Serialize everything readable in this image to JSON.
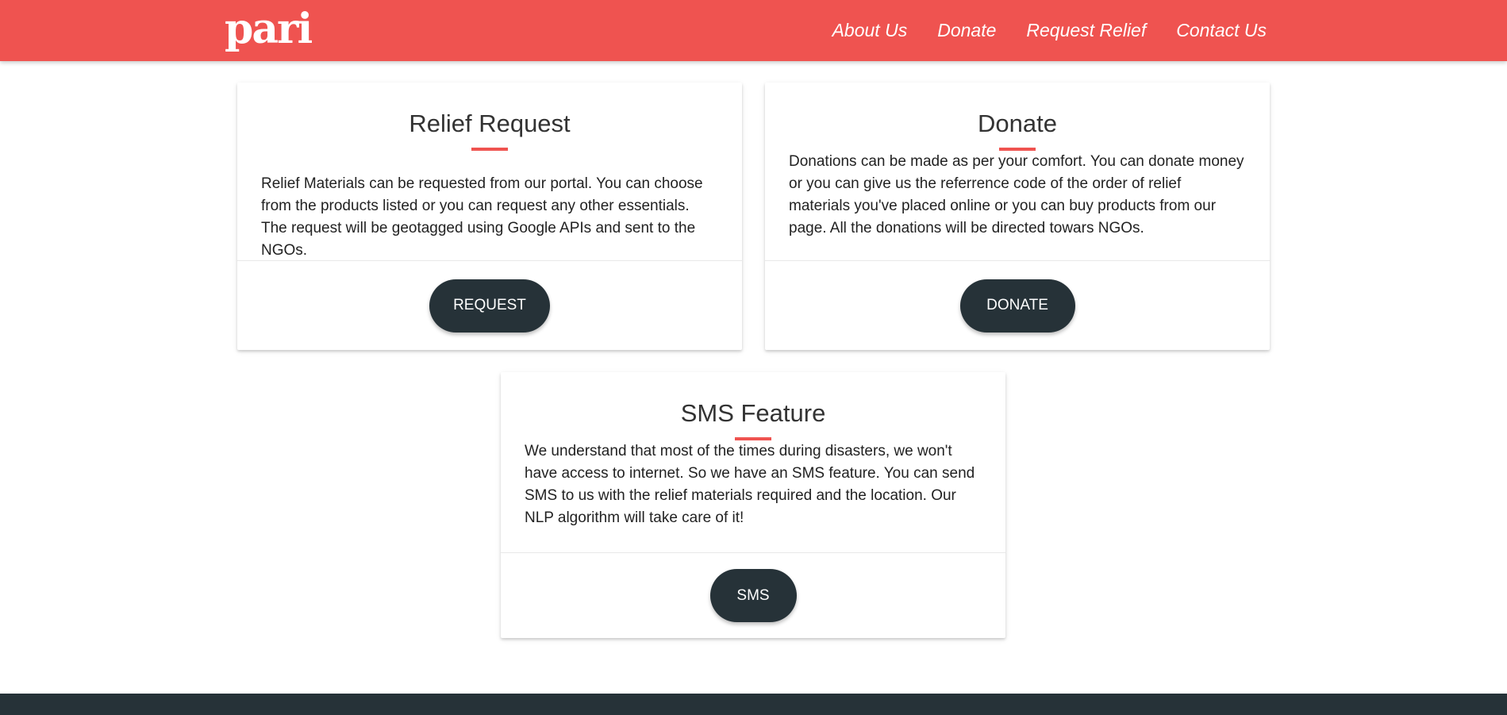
{
  "brand": {
    "logo_text": "pari"
  },
  "nav": {
    "items": [
      {
        "label": "About Us"
      },
      {
        "label": "Donate"
      },
      {
        "label": "Request Relief"
      },
      {
        "label": "Contact Us"
      }
    ]
  },
  "cards": {
    "relief": {
      "title": "Relief Request",
      "text": "Relief Materials can be requested from our portal. You can choose from the products listed or you can request any other essentials. The request will be geotagged using Google APIs and sent to the NGOs.",
      "button": "REQUEST"
    },
    "donate": {
      "title": "Donate",
      "text": "Donations can be made as per your comfort. You can donate money or you can give us the referrence code of the order of relief materials you've placed online or you can buy products from our page. All the donations will be directed towars NGOs.",
      "button": "DONATE"
    },
    "sms": {
      "title": "SMS Feature",
      "text": "We understand that most of the times during disasters, we won't have access to internet. So we have an SMS feature. You can send SMS to us with the relief materials required and the location. Our NLP algorithm will take care of it!",
      "button": "SMS"
    }
  },
  "colors": {
    "primary": "#ef5350",
    "dark": "#263238",
    "white": "#ffffff"
  }
}
